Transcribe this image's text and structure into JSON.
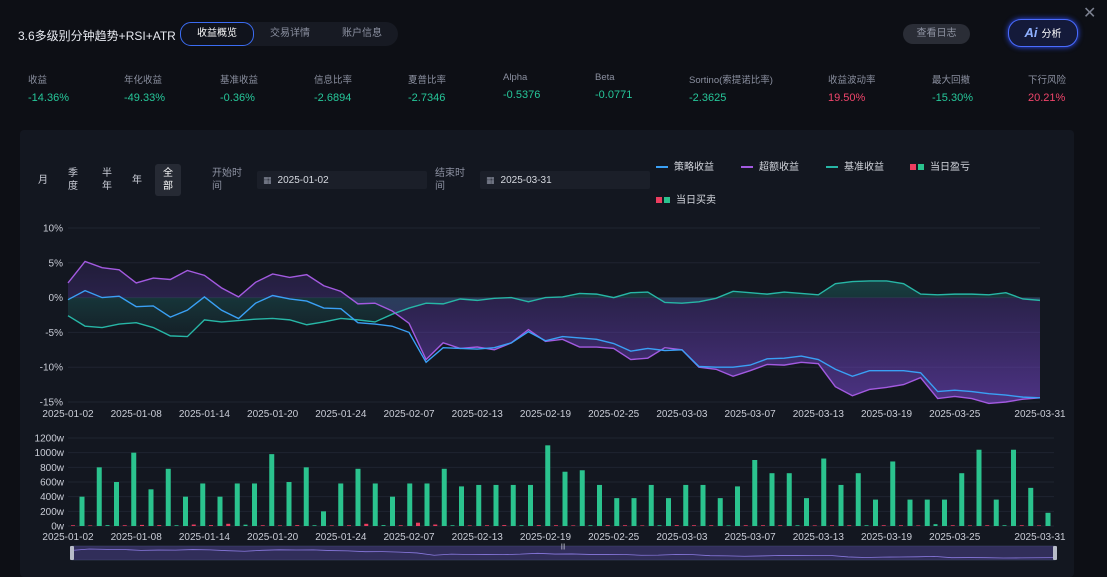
{
  "header": {
    "title": "3.6多级别分钟趋势+RSI+ATR",
    "tabs": [
      {
        "label": "收益概览",
        "active": true
      },
      {
        "label": "交易详情"
      },
      {
        "label": "账户信息"
      }
    ],
    "log_button": "查看日志",
    "ai_icon_text": "Ai",
    "ai_button": "分析",
    "close_glyph": "✕"
  },
  "metrics": [
    {
      "label": "收益",
      "value": "-14.36%",
      "color": "#26c79a"
    },
    {
      "label": "年化收益",
      "value": "-49.33%",
      "color": "#26c79a"
    },
    {
      "label": "基准收益",
      "value": "-0.36%",
      "color": "#26c79a"
    },
    {
      "label": "信息比率",
      "value": "-2.6894",
      "color": "#26c79a"
    },
    {
      "label": "夏普比率",
      "value": "-2.7346",
      "color": "#26c79a"
    },
    {
      "label": "Alpha",
      "value": "-0.5376",
      "color": "#26c79a"
    },
    {
      "label": "Beta",
      "value": "-0.0771",
      "color": "#26c79a"
    },
    {
      "label": "Sortino(索提诺比率)",
      "value": "-2.3625",
      "color": "#26c79a"
    },
    {
      "label": "收益波动率",
      "value": "19.50%",
      "color": "#f0456b"
    },
    {
      "label": "最大回撤",
      "value": "-15.30%",
      "color": "#26c79a"
    },
    {
      "label": "下行风险",
      "value": "20.21%",
      "color": "#f0456b"
    }
  ],
  "filters": {
    "ranges": [
      {
        "label": "月"
      },
      {
        "label": "季\n度"
      },
      {
        "label": "半\n年"
      },
      {
        "label": "年"
      },
      {
        "label": "全\n部",
        "selected": true
      }
    ],
    "start_label": "开始时\n间",
    "start_date": "2025-01-02",
    "end_label": "结束时\n间",
    "end_date": "2025-03-31"
  },
  "legend": {
    "strategy": "策略收益",
    "excess": "超额收益",
    "benchmark": "基准收益",
    "daily_pnl": "当日盈亏",
    "daily_trade": "当日买卖"
  },
  "colors": {
    "strategy": "#3aa0f5",
    "excess": "#a35ae0",
    "benchmark": "#27b6a6",
    "up": "#2bc38e",
    "down": "#ec3d5f"
  },
  "chart_data": [
    {
      "type": "line",
      "ylim": [
        -15,
        10
      ],
      "yticks": [
        "10%",
        "5%",
        "0%",
        "-5%",
        "-10%",
        "-15%"
      ],
      "ytick_values": [
        10,
        5,
        0,
        -5,
        -10,
        -15
      ],
      "xtick_labels": [
        "2025-01-02",
        "2025-01-08",
        "2025-01-14",
        "2025-01-20",
        "2025-01-24",
        "2025-02-07",
        "2025-02-13",
        "2025-02-19",
        "2025-02-25",
        "2025-03-03",
        "2025-03-07",
        "2025-03-13",
        "2025-03-19",
        "2025-03-25",
        "2025-03-31"
      ],
      "xtick_index": [
        0,
        4,
        8,
        12,
        16,
        20,
        24,
        28,
        32,
        36,
        40,
        44,
        48,
        52,
        57
      ],
      "series": [
        {
          "name": "策略收益",
          "values": [
            -0.3,
            1.0,
            0.0,
            0.2,
            -1.3,
            -1.2,
            -2.8,
            -1.8,
            0.1,
            -1.8,
            -3.0,
            -0.8,
            0.3,
            -0.2,
            -0.5,
            -1.5,
            -1.6,
            -3.6,
            -3.8,
            -4.1,
            -5.0,
            -9.3,
            -7.2,
            -7.3,
            -7.4,
            -7.2,
            -6.5,
            -4.9,
            -6.2,
            -5.6,
            -5.8,
            -6.0,
            -6.6,
            -7.7,
            -7.3,
            -7.6,
            -7.5,
            -9.9,
            -10.0,
            -10.0,
            -9.7,
            -8.8,
            -8.7,
            -8.4,
            -8.9,
            -10.3,
            -11.3,
            -10.5,
            -10.5,
            -10.5,
            -10.8,
            -13.5,
            -13.3,
            -13.5,
            -13.8,
            -14.0,
            -14.3,
            -14.4
          ]
        },
        {
          "name": "超额收益",
          "values": [
            2.1,
            5.2,
            4.3,
            4.0,
            2.1,
            2.8,
            2.6,
            3.9,
            3.2,
            1.4,
            0.1,
            2.2,
            3.4,
            2.9,
            3.3,
            1.7,
            0.9,
            -0.9,
            -0.8,
            -1.9,
            -3.7,
            -8.9,
            -6.5,
            -7.3,
            -7.1,
            -7.5,
            -6.5,
            -4.6,
            -6.3,
            -6.0,
            -7.1,
            -7.1,
            -7.3,
            -8.9,
            -8.7,
            -7.2,
            -7.5,
            -10.0,
            -10.3,
            -11.3,
            -10.5,
            -9.6,
            -9.7,
            -9.3,
            -9.5,
            -12.8,
            -14.1,
            -13.2,
            -12.9,
            -12.5,
            -11.5,
            -14.5,
            -14.2,
            -14.5,
            -15.2,
            -15.0,
            -14.6,
            -14.4
          ]
        },
        {
          "name": "基准收益",
          "values": [
            -2.6,
            -4.1,
            -4.3,
            -3.8,
            -3.6,
            -4.3,
            -5.5,
            -5.6,
            -3.2,
            -3.5,
            -3.3,
            -3.1,
            -3.0,
            -3.2,
            -3.9,
            -3.5,
            -3.0,
            -3.2,
            -3.5,
            -2.4,
            -1.5,
            -0.8,
            -0.9,
            -0.2,
            -0.4,
            -0.1,
            0.0,
            -0.6,
            0.0,
            0.1,
            0.6,
            0.5,
            0.0,
            0.7,
            0.8,
            -0.7,
            -0.8,
            -0.6,
            -0.1,
            0.9,
            0.7,
            0.5,
            0.8,
            0.6,
            0.4,
            2.0,
            2.3,
            2.4,
            2.4,
            2.0,
            0.5,
            0.4,
            0.5,
            0.5,
            0.4,
            0.7,
            -0.2,
            -0.4
          ]
        }
      ]
    },
    {
      "type": "bar",
      "ylim": [
        0,
        1200
      ],
      "yticks": [
        "1200w",
        "1000w",
        "800w",
        "600w",
        "400w",
        "200w",
        "0w"
      ],
      "ytick_values": [
        1200,
        1000,
        800,
        600,
        400,
        200,
        0
      ],
      "series": [
        {
          "name": "当日买卖",
          "values": [
            400,
            800,
            600,
            1000,
            500,
            780,
            400,
            580,
            400,
            580,
            580,
            980,
            600,
            800,
            200,
            580,
            780,
            580,
            400,
            580,
            580,
            780,
            540,
            560,
            560,
            560,
            560,
            1100,
            740,
            760,
            560,
            380,
            380,
            560,
            380,
            560,
            560,
            380,
            540,
            900,
            720,
            720,
            380,
            920,
            560,
            720,
            360,
            880,
            360,
            360,
            360,
            720,
            1040,
            360,
            1040,
            520,
            180
          ]
        },
        {
          "name": "当日盈亏",
          "values": [
            10,
            8,
            12,
            10,
            15,
            12,
            10,
            20,
            12,
            30,
            18,
            10,
            8,
            12,
            10,
            8,
            10,
            30,
            12,
            10,
            45,
            20,
            10,
            8,
            10,
            12,
            10,
            12,
            10,
            8,
            10,
            12,
            10,
            8,
            10,
            12,
            10,
            10,
            8,
            10,
            10,
            10,
            10,
            8,
            10,
            10,
            10,
            10,
            10,
            8,
            25,
            10,
            8,
            10,
            10,
            10,
            8
          ]
        }
      ]
    }
  ],
  "slider": {
    "handle_glyph": "|||"
  }
}
